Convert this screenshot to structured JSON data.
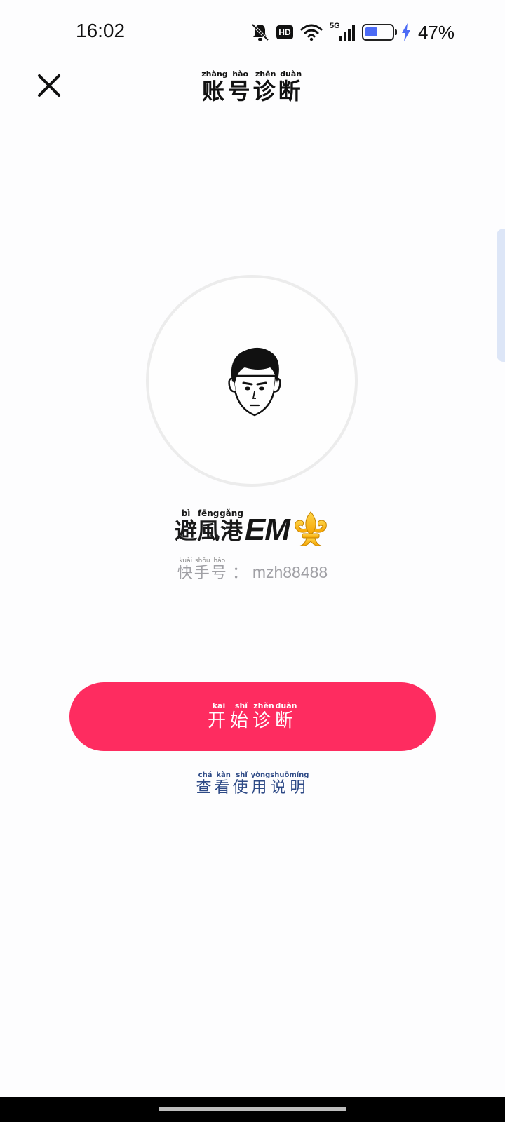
{
  "status_bar": {
    "time": "16:02",
    "hd_label": "HD",
    "network_label": "5G",
    "battery_level": 0.47,
    "battery_percent": "47%",
    "icons": [
      "bell-muted-icon",
      "hd-icon",
      "wifi-icon",
      "signal-5g-icon",
      "battery-icon",
      "charging-bolt-icon"
    ]
  },
  "header": {
    "close_icon": "close-icon",
    "title_chars": [
      {
        "char": "账",
        "pinyin": "zhàng"
      },
      {
        "char": "号",
        "pinyin": "hào"
      },
      {
        "char": "诊",
        "pinyin": "zhěn"
      },
      {
        "char": "断",
        "pinyin": "duàn"
      }
    ]
  },
  "profile": {
    "avatar_icon": "cartoon-boy-avatar-icon",
    "nickname_chars": [
      {
        "char": "避",
        "pinyin": "bì"
      },
      {
        "char": "風",
        "pinyin": "fēng"
      },
      {
        "char": "港",
        "pinyin": "gǎng"
      }
    ],
    "nickname_suffix": "EM",
    "nickname_emoji": "fleur-de-lis-icon",
    "account_label_chars": [
      {
        "char": "快",
        "pinyin": "kuài"
      },
      {
        "char": "手",
        "pinyin": "shǒu"
      },
      {
        "char": "号",
        "pinyin": "hào"
      }
    ],
    "account_separator": "：",
    "account_value": "mzh88488"
  },
  "actions": {
    "start_chars": [
      {
        "char": "开",
        "pinyin": "kāi"
      },
      {
        "char": "始",
        "pinyin": "shǐ"
      },
      {
        "char": "诊",
        "pinyin": "zhěn"
      },
      {
        "char": "断",
        "pinyin": "duàn"
      }
    ],
    "instructions_chars": [
      {
        "char": "查",
        "pinyin": "chá"
      },
      {
        "char": "看",
        "pinyin": "kàn"
      },
      {
        "char": "使",
        "pinyin": "shǐ"
      },
      {
        "char": "用",
        "pinyin": "yòng"
      },
      {
        "char": "说",
        "pinyin": "shuō"
      },
      {
        "char": "明",
        "pinyin": "míng"
      }
    ]
  },
  "colors": {
    "primary_button": "#fe2c60",
    "link": "#2e4a86",
    "battery_fill": "#4c6bf5",
    "charging_bolt": "#4c6bf5",
    "muted_text": "#a0a0a5"
  }
}
